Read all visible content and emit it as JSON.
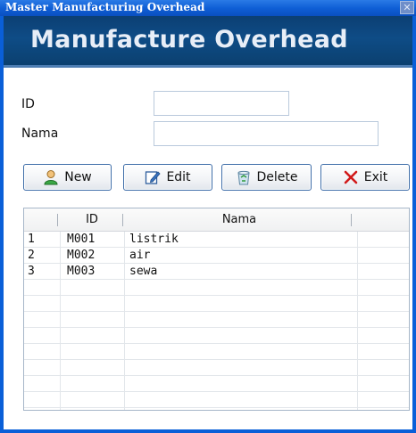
{
  "window": {
    "title": "Master Manufacturing Overhead",
    "close_glyph": "✕",
    "banner": "Manufacture Overhead"
  },
  "form": {
    "id_label": "ID",
    "nama_label": "Nama",
    "id_value": "",
    "nama_value": ""
  },
  "toolbar": {
    "new_label": "New",
    "edit_label": "Edit",
    "delete_label": "Delete",
    "exit_label": "Exit",
    "new_icon": "user-icon",
    "edit_icon": "edit-icon",
    "delete_icon": "recycle-bin-icon",
    "exit_icon": "close-x-icon"
  },
  "grid": {
    "columns": [
      "",
      "ID",
      "Nama"
    ],
    "rows": [
      {
        "no": "1",
        "id": "M001",
        "nama": "listrik"
      },
      {
        "no": "2",
        "id": "M002",
        "nama": "air"
      },
      {
        "no": "3",
        "id": "M003",
        "nama": "sewa"
      }
    ],
    "empty_rows": 8
  },
  "colors": {
    "title_bar": "#0f5fd6",
    "banner": "#0e4c86",
    "button_border": "#3e6da8",
    "exit_icon": "#d11a1a"
  }
}
